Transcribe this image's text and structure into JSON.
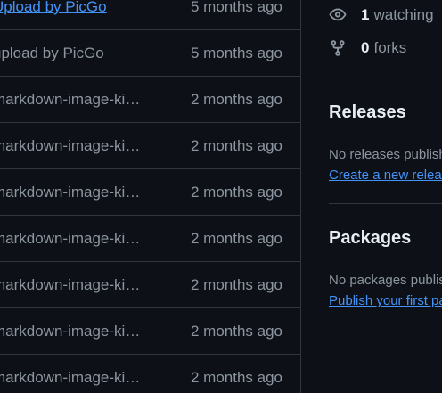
{
  "files": {
    "rows": [
      {
        "message": "Upload by PicGo",
        "time": "5 months ago"
      },
      {
        "message": "upload by PicGo",
        "time": "5 months ago"
      },
      {
        "message": "markdown-image-ki…",
        "time": "2 months ago"
      },
      {
        "message": "markdown-image-ki…",
        "time": "2 months ago"
      },
      {
        "message": "markdown-image-ki…",
        "time": "2 months ago"
      },
      {
        "message": "markdown-image-ki…",
        "time": "2 months ago"
      },
      {
        "message": "markdown-image-ki…",
        "time": "2 months ago"
      },
      {
        "message": "markdown-image-ki…",
        "time": "2 months ago"
      },
      {
        "message": "markdown-image-ki…",
        "time": "2 months ago"
      }
    ]
  },
  "sidebar": {
    "watching": {
      "count": "1",
      "label": "watching",
      "icon": "eye-icon"
    },
    "forks": {
      "count": "0",
      "label": "forks",
      "icon": "repo-forked-icon"
    },
    "releases": {
      "title": "Releases",
      "empty_text": "No releases published",
      "create_link": "Create a new release"
    },
    "packages": {
      "title": "Packages",
      "empty_text": "No packages published",
      "publish_link": "Publish your first package"
    }
  },
  "colors": {
    "background": "#0d1117",
    "border": "#30363d",
    "muted_text": "#8d96a0",
    "primary_text": "#e6edf3",
    "link": "#4493f8"
  }
}
